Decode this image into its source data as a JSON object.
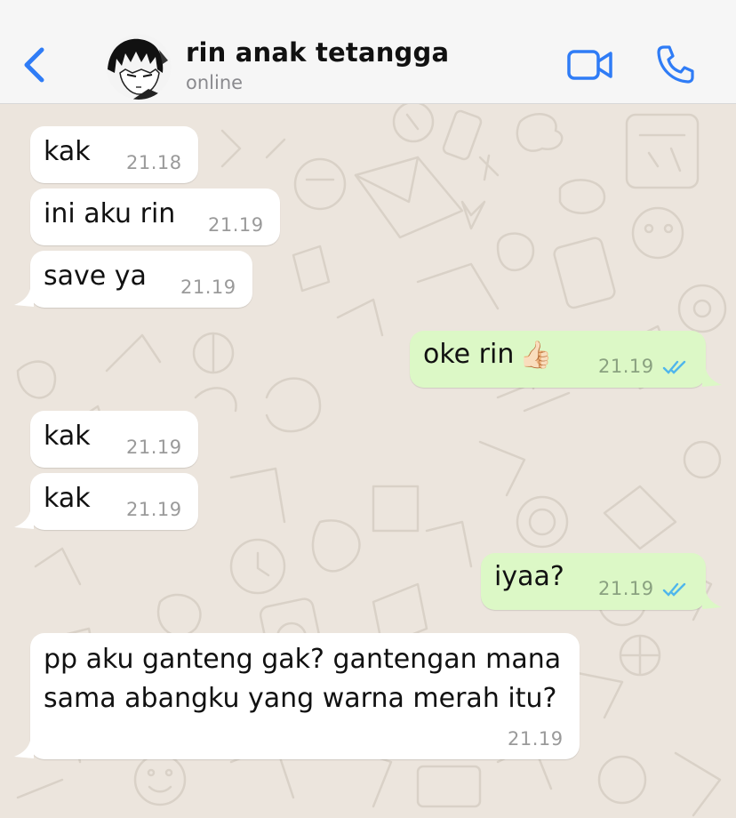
{
  "header": {
    "contact_name": "rin anak tetangga",
    "status": "online",
    "back_icon": "chevron-left-icon",
    "video_icon": "video-camera-icon",
    "call_icon": "phone-icon",
    "accent_color": "#2f7cf6"
  },
  "messages": [
    {
      "direction": "incoming",
      "text": "kak",
      "time": "21.18"
    },
    {
      "direction": "incoming",
      "text": "ini aku rin",
      "time": "21.19"
    },
    {
      "direction": "incoming",
      "text": "save ya",
      "time": "21.19"
    },
    {
      "direction": "outgoing",
      "text": "oke rin",
      "emoji": "👍🏻",
      "time": "21.19",
      "read": true
    },
    {
      "direction": "incoming",
      "text": "kak",
      "time": "21.19"
    },
    {
      "direction": "incoming",
      "text": "kak",
      "time": "21.19"
    },
    {
      "direction": "outgoing",
      "text": "iyaa?",
      "time": "21.19",
      "read": true
    },
    {
      "direction": "incoming",
      "text_line1": "pp aku ganteng gak? gantengan mana",
      "text_line2": "sama abangku yang warna merah itu?",
      "time": "21.19"
    }
  ],
  "colors": {
    "incoming_bubble": "#ffffff",
    "outgoing_bubble": "#dcf8c6",
    "read_ticks": "#4fb6ec",
    "wallpaper": "#ece5dd"
  }
}
